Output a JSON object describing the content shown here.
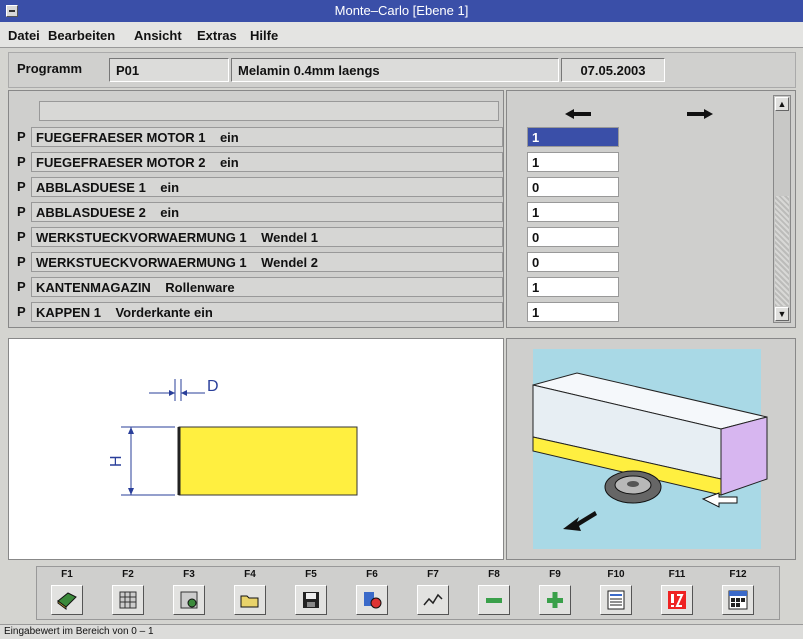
{
  "window": {
    "title": "Monte–Carlo [Ebene 1]"
  },
  "menu": [
    "Datei",
    "Bearbeiten",
    "Ansicht",
    "Extras",
    "Hilfe"
  ],
  "header": {
    "label": "Programm",
    "program": "P01",
    "description": "Melamin 0.4mm  laengs",
    "date": "07.05.2003"
  },
  "params": [
    {
      "key": "P",
      "name": "FUEGEFRAESER MOTOR 1    ein",
      "value": "1"
    },
    {
      "key": "P",
      "name": "FUEGEFRAESER MOTOR 2    ein",
      "value": "1"
    },
    {
      "key": "P",
      "name": "ABBLASDUESE 1    ein",
      "value": "0"
    },
    {
      "key": "P",
      "name": "ABBLASDUESE 2    ein",
      "value": "1"
    },
    {
      "key": "P",
      "name": "WERKSTUECKVORWAERMUNG 1    Wendel 1",
      "value": "0"
    },
    {
      "key": "P",
      "name": "WERKSTUECKVORWAERMUNG 1    Wendel 2",
      "value": "0"
    },
    {
      "key": "P",
      "name": "KANTENMAGAZIN    Rollenware",
      "value": "1"
    },
    {
      "key": "P",
      "name": "KAPPEN 1    Vorderkante ein",
      "value": "1"
    }
  ],
  "diagram": {
    "d_label": "D",
    "h_label": "H"
  },
  "fkeys": [
    "F1",
    "F2",
    "F3",
    "F4",
    "F5",
    "F6",
    "F7",
    "F8",
    "F9",
    "F10",
    "F11",
    "F12"
  ],
  "fkey_icons": [
    "book-icon",
    "grid-icon",
    "settings-icon",
    "open-folder-icon",
    "save-icon",
    "tool-icon",
    "graph-icon",
    "minus-icon",
    "plus-icon",
    "list-icon",
    "error-icon",
    "calendar-icon"
  ],
  "status": "Eingabewert im Bereich von 0 – 1",
  "colors": {
    "title_bar": "#3a4fa8",
    "workpiece": "#ffef40",
    "edge_band": "#d7b6f0",
    "scene_bg": "#a9d9e6"
  }
}
